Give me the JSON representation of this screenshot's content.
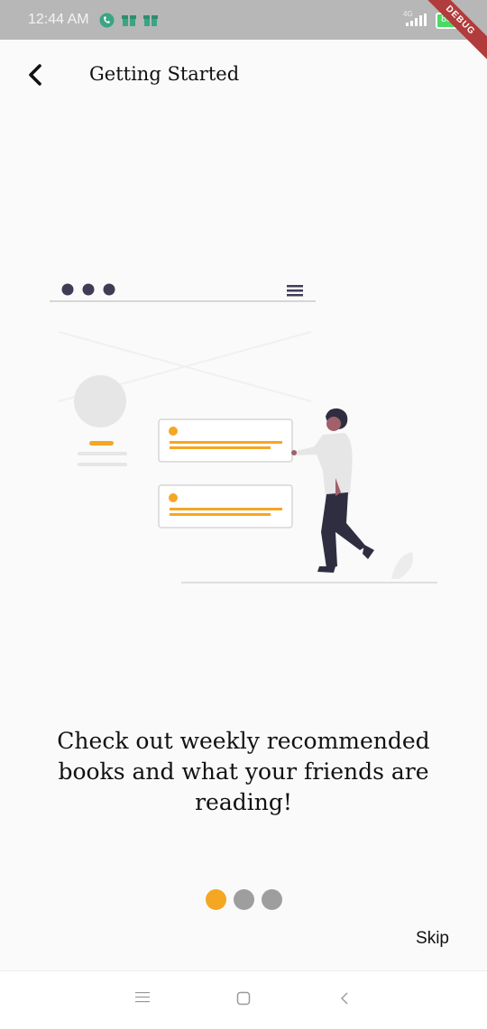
{
  "status_bar": {
    "time": "12:44 AM",
    "icons": [
      "phone-call-icon",
      "notification-gift-icon",
      "notification-gift-icon"
    ],
    "network": "4G",
    "battery": "83",
    "debug_banner": "DEBUG"
  },
  "app_bar": {
    "back_icon": "chevron-left-icon",
    "title": "Getting Started"
  },
  "onboarding": {
    "caption": "Check out weekly recommended books and what your friends are reading!",
    "page_indicator": {
      "current": 1,
      "total": 3
    },
    "skip_label": "Skip"
  },
  "colors": {
    "accent": "#f5a623",
    "dot_inactive": "#9e9e9e",
    "dark": "#3f3d56",
    "background": "#fafafa"
  },
  "nav_bar": {
    "buttons": [
      "menu-icon",
      "home-square-icon",
      "back-chevron-icon"
    ]
  }
}
